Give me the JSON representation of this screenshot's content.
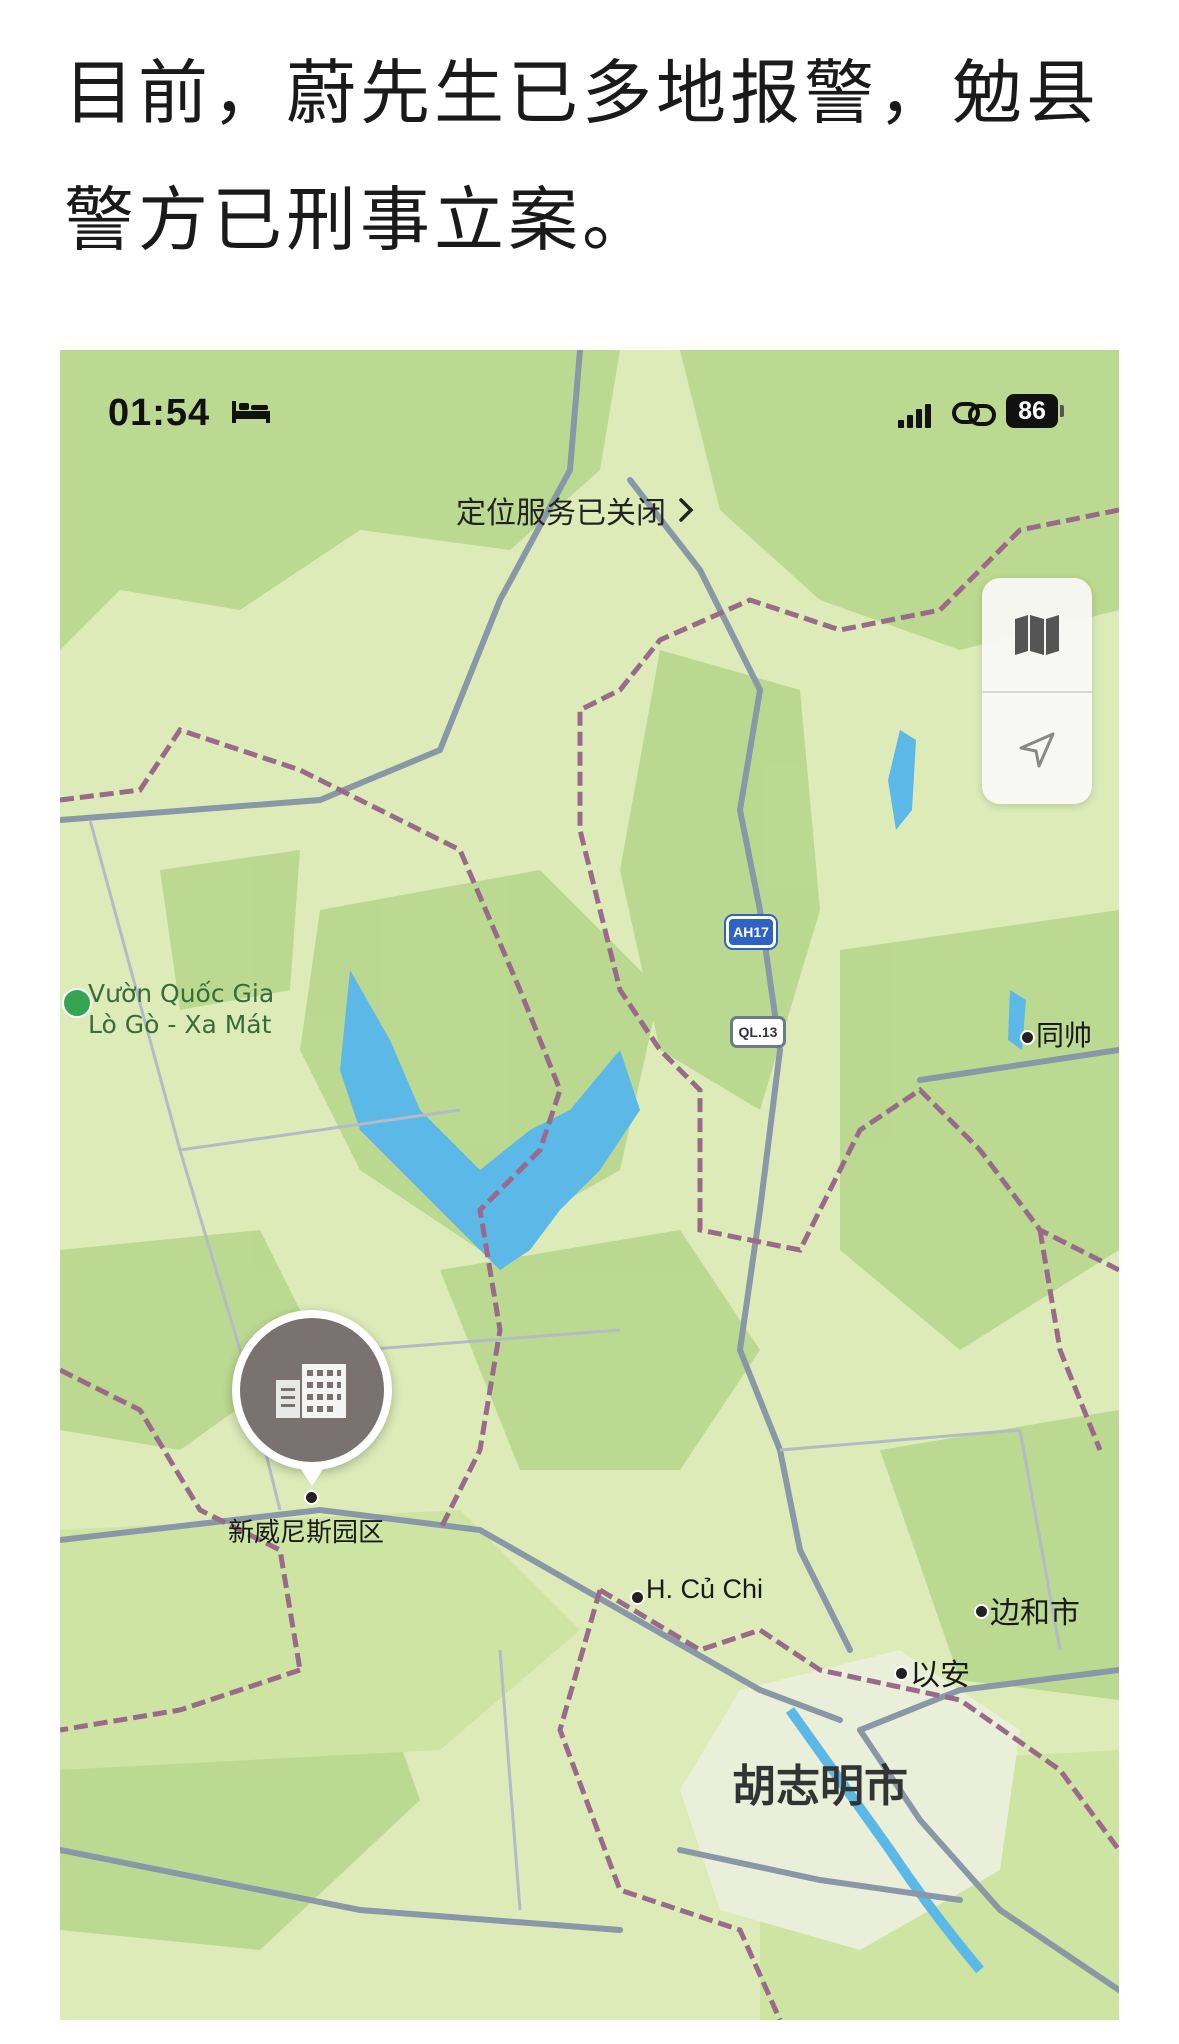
{
  "article": {
    "line1": "目前，蔚先生已多地报警，勉县",
    "line2": "警方已刑事立案。"
  },
  "phone": {
    "status_bar": {
      "time": "01:54",
      "battery": "86"
    },
    "location_banner": "定位服务已关闭",
    "map": {
      "shields": {
        "ah17": "AH17",
        "ql13": "QL.13"
      },
      "park_label_line1": "Vườn Quốc Gia",
      "park_label_line2": "Lò Gò - Xa Mát",
      "pin_label": "新威尼斯园区",
      "places": {
        "dong_shuai": "同帅",
        "cu_chi": "H. Củ Chi",
        "bien_hoa": "边和市",
        "di_an": "以安",
        "hcmc": "胡志明市"
      }
    },
    "colors": {
      "water": "#5cb8e6",
      "land": "#dcebb8",
      "forest": "#b9d98f",
      "border": "#9a6a8a",
      "road": "#8a97a6"
    },
    "icons": [
      "bed-icon",
      "signal-icon",
      "link-icon",
      "chevron-right-icon",
      "map-icon",
      "location-arrow-icon",
      "building-icon",
      "park-icon"
    ]
  }
}
